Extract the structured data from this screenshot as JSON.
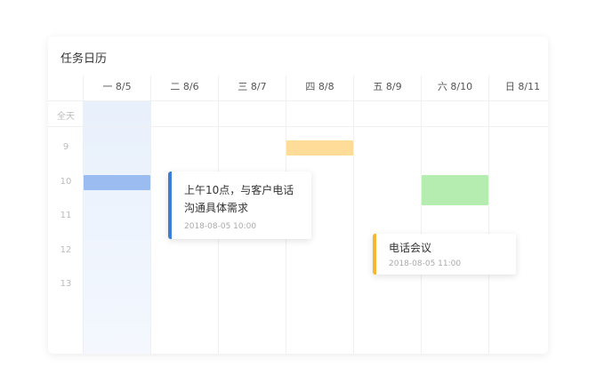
{
  "calendar": {
    "title": "任务日历",
    "all_day_label": "全天",
    "days": [
      {
        "label": "一 8/5"
      },
      {
        "label": "二 8/6"
      },
      {
        "label": "三 8/7"
      },
      {
        "label": "四 8/8"
      },
      {
        "label": "五 8/9"
      },
      {
        "label": "六 8/10"
      },
      {
        "label": "日 8/11"
      }
    ],
    "hours": [
      "9",
      "10",
      "11",
      "12",
      "13"
    ]
  },
  "events": [
    {
      "color": "#ffdd99"
    },
    {
      "color": "#9bbcf0"
    },
    {
      "color": "#b5edb0"
    }
  ],
  "popups": [
    {
      "title_line1": "上午10点，与客户电话",
      "title_line2": "沟通具体需求",
      "date": "2018-08-05  10:00",
      "accent": "#3b7ed8"
    },
    {
      "title_line1": "电话会议",
      "date": "2018-08-05  11:00",
      "accent": "#f5b731"
    }
  ]
}
